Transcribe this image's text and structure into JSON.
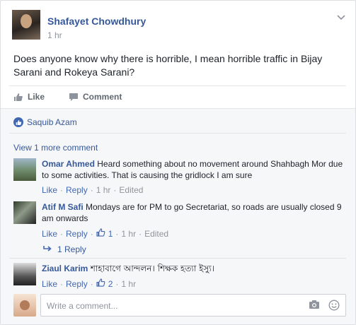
{
  "post": {
    "author": "Shafayet Chowdhury",
    "time": "1 hr",
    "text": "Does anyone know why there is horrible, I mean horrible traffic in Bijay Sarani and Rokeya Sarani?",
    "actions": {
      "like": "Like",
      "comment": "Comment"
    }
  },
  "likes": {
    "name": "Saquib Azam"
  },
  "view_more": "View 1 more comment",
  "comments": [
    {
      "name": "Omar Ahmed",
      "text": "Heard something about no movement around Shahbagh Mor due to some activities. That is causing the gridlock I am sure",
      "like": "Like",
      "dot1": "·",
      "reply": "Reply",
      "dot2": "·",
      "time": "1 hr",
      "dot3": "·",
      "edited": "Edited"
    },
    {
      "name": "Atif M Safi",
      "text": "Mondays are for PM to go Secretariat, so roads are usually closed 9 am onwards",
      "like": "Like",
      "dot1": "·",
      "reply": "Reply",
      "dot2": "·",
      "likes": "1",
      "dot3": "·",
      "time": "1 hr",
      "dot4": "·",
      "edited": "Edited",
      "replies": "1 Reply"
    },
    {
      "name": "Ziaul Karim",
      "text": "শাহাবাগে আন্দলন। শিক্ষক হত্যা ইস্যু।",
      "like": "Like",
      "dot1": "·",
      "reply": "Reply",
      "dot2": "·",
      "likes": "2",
      "dot3": "·",
      "time": "1 hr"
    }
  ],
  "composer": {
    "placeholder": "Write a comment..."
  },
  "colors": {
    "link": "#365899",
    "brand": "#4267b2",
    "meta": "#90949c"
  }
}
